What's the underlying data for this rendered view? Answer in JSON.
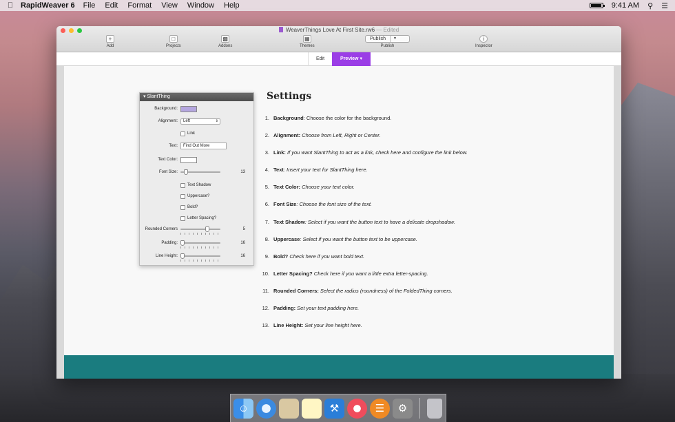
{
  "menubar": {
    "app_name": "RapidWeaver 6",
    "menus": [
      "File",
      "Edit",
      "Format",
      "View",
      "Window",
      "Help"
    ],
    "clock": "9:41 AM"
  },
  "window": {
    "title": "WeaverThings Love At First Site.rw6",
    "edited_suffix": "— Edited",
    "toolbar": {
      "add": "Add",
      "projects": "Projects",
      "addons": "Addons",
      "themes": "Themes",
      "publish_button": "Publish",
      "publish": "Publish",
      "inspector": "Inspector"
    },
    "tabs": {
      "edit": "Edit",
      "preview": "Preview"
    }
  },
  "panel": {
    "title": "SlantThing",
    "background_label": "Background:",
    "alignment_label": "Alignment:",
    "alignment_value": "Left",
    "link_label": "Link",
    "text_label": "Text:",
    "text_value": "Find Out More",
    "text_color_label": "Text Color:",
    "font_size_label": "Font Size:",
    "font_size_value": "13",
    "font_size_level": 0.1,
    "text_shadow_label": "Text Shadow",
    "uppercase_label": "Uppercase?",
    "bold_label": "Bold?",
    "letter_spacing_label": "Letter Spacing?",
    "rounded_corners_label": "Rounded Corners",
    "rounded_corners_value": "5",
    "rounded_corners_level": 0.7,
    "padding_label": "Padding:",
    "padding_value": "16",
    "padding_level": 0.0,
    "line_height_label": "Line Height:",
    "line_height_value": "16",
    "line_height_level": 0.0,
    "colors": {
      "background_swatch": "#b5a7e0",
      "text_color_swatch": "#ffffff"
    }
  },
  "settings": {
    "title": "Settings",
    "items": [
      {
        "num": "1.",
        "term": "Background",
        "desc": ": Choose the color for the background."
      },
      {
        "num": "2.",
        "term": "Alignment:",
        "desc": " Choose from Left, Right or Center."
      },
      {
        "num": "3.",
        "term": "Link:",
        "desc": " If you want SlantThing to act as a link, check here and configure the link below."
      },
      {
        "num": "4.",
        "term": "Text",
        "desc": ": Insert your text for SlantThing here."
      },
      {
        "num": "5.",
        "term": "Text Color:",
        "desc": " Choose your text color."
      },
      {
        "num": "6.",
        "term": "Font Size",
        "desc": ": Choose the font size of the text."
      },
      {
        "num": "7.",
        "term": "Text Shadow",
        "desc": ": Select if you want the button text to have a delicate dropshadow."
      },
      {
        "num": "8.",
        "term": "Uppercase",
        "desc": ": Select if you want the button text to be uppercase."
      },
      {
        "num": "9.",
        "term": "Bold?",
        "desc": " Check here if you want bold text."
      },
      {
        "num": "10.",
        "term": "Letter Spacing?",
        "desc": " Check here if you want a little extra letter-spacing."
      },
      {
        "num": "11.",
        "term": "Rounded Corners:",
        "desc": " Select the radius (roundness) of the FoldedThing corners."
      },
      {
        "num": "12.",
        "term": "Padding:",
        "desc": " Set your text padding here."
      },
      {
        "num": "13.",
        "term": "Line Height:",
        "desc": " Set your line height here."
      }
    ]
  },
  "colors": {
    "accent": "#9b3ee6",
    "teal_footer": "#1a7c7f"
  }
}
